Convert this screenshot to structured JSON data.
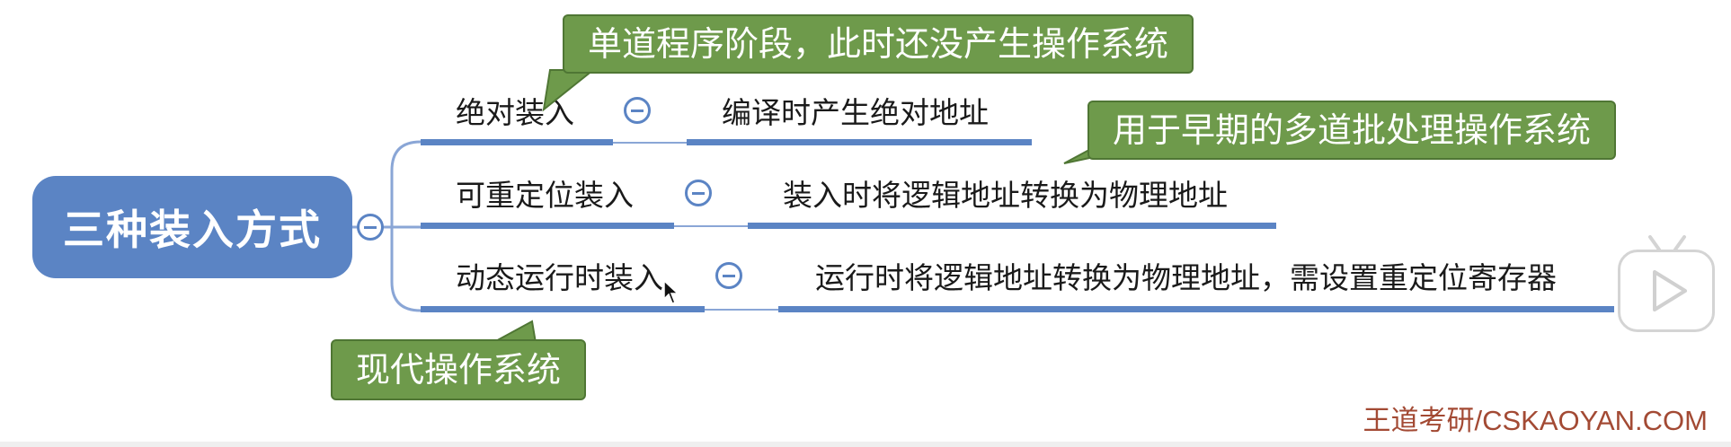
{
  "mindmap": {
    "root": "三种装入方式",
    "branches": [
      {
        "label": "绝对装入",
        "description": "编译时产生绝对地址"
      },
      {
        "label": "可重定位装入",
        "description": "装入时将逻辑地址转换为物理地址"
      },
      {
        "label": "动态运行时装入",
        "description": "运行时将逻辑地址转换为物理地址，需设置重定位寄存器"
      }
    ]
  },
  "callouts": {
    "absolute": "单道程序阶段，此时还没产生操作系统",
    "relocatable": "用于早期的多道批处理操作系统",
    "dynamic": "现代操作系统"
  },
  "watermark": "王道考研/CSKAOYAN.COM",
  "colors": {
    "node_blue": "#5b84c4",
    "callout_green": "#6e9a4b",
    "watermark_red": "#a34a34"
  },
  "icons": {
    "collapse": "collapse-minus-icon",
    "play": "play-icon",
    "cursor": "mouse-cursor-icon"
  }
}
